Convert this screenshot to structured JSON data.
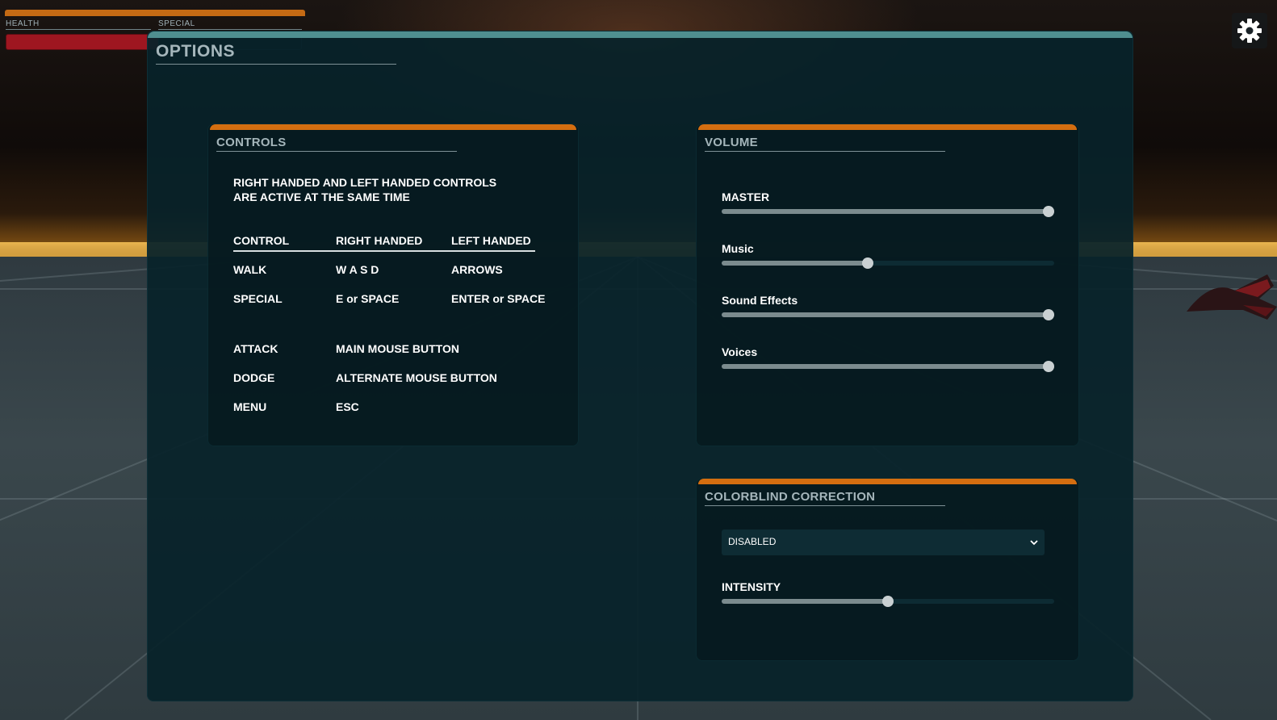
{
  "hud": {
    "health_label": "HEALTH",
    "special_label": "SPECIAL",
    "health_fraction": 1.0,
    "special_fraction": 0.0
  },
  "settings_icon": "gear-icon",
  "options": {
    "title": "OPTIONS"
  },
  "controls": {
    "title": "CONTROLS",
    "info": [
      "RIGHT HANDED AND LEFT HANDED CONTROLS",
      "ARE ACTIVE AT THE SAME TIME"
    ],
    "headers": [
      "CONTROL",
      "RIGHT HANDED",
      "LEFT HANDED"
    ],
    "rows": [
      [
        "WALK",
        "W A S D",
        "ARROWS"
      ],
      [
        "SPECIAL",
        "E or SPACE",
        "ENTER or SPACE"
      ],
      [
        "ATTACK",
        "MAIN MOUSE BUTTON",
        ""
      ],
      [
        "DODGE",
        "ALTERNATE MOUSE BUTTON",
        ""
      ],
      [
        "MENU",
        "ESC",
        ""
      ]
    ]
  },
  "volume": {
    "title": "VOLUME",
    "sliders": [
      {
        "label": "MASTER",
        "value": 1.0
      },
      {
        "label": "Music",
        "value": 0.44
      },
      {
        "label": "Sound Effects",
        "value": 1.0
      },
      {
        "label": "Voices",
        "value": 1.0
      }
    ]
  },
  "colorblind": {
    "title": "COLORBLIND CORRECTION",
    "dropdown_value": "DISABLED",
    "intensity_label": "INTENSITY",
    "intensity_value": 0.5
  },
  "colors": {
    "panel_accent": "#d46e10",
    "window_accent": "#4f8f90",
    "health": "#9e1620"
  }
}
